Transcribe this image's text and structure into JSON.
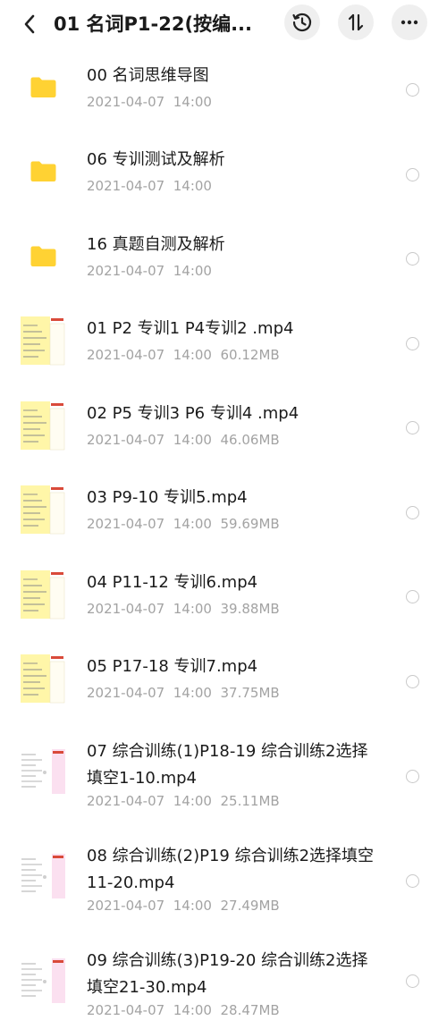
{
  "header": {
    "title": "01 名词P1-22(按编...",
    "back_icon": "back-chevron-icon",
    "history_icon": "history-icon",
    "sort_icon": "sort-icon",
    "more_icon": "more-icon"
  },
  "files": [
    {
      "name": "00 名词思维导图",
      "date": "2021-04-07",
      "time": "14:00",
      "size": "",
      "kind": "folder"
    },
    {
      "name": "06 专训测试及解析",
      "date": "2021-04-07",
      "time": "14:00",
      "size": "",
      "kind": "folder"
    },
    {
      "name": "16 真题自测及解析",
      "date": "2021-04-07",
      "time": "14:00",
      "size": "",
      "kind": "folder"
    },
    {
      "name": "01 P2 专训1 P4专训2 .mp4",
      "date": "2021-04-07",
      "time": "14:00",
      "size": "60.12MB",
      "kind": "video-yellow"
    },
    {
      "name": "02 P5 专训3 P6 专训4 .mp4",
      "date": "2021-04-07",
      "time": "14:00",
      "size": "46.06MB",
      "kind": "video-yellow"
    },
    {
      "name": "03 P9-10 专训5.mp4",
      "date": "2021-04-07",
      "time": "14:00",
      "size": "59.69MB",
      "kind": "video-yellow"
    },
    {
      "name": "04 P11-12 专训6.mp4",
      "date": "2021-04-07",
      "time": "14:00",
      "size": "39.88MB",
      "kind": "video-yellow"
    },
    {
      "name": "05 P17-18 专训7.mp4",
      "date": "2021-04-07",
      "time": "14:00",
      "size": "37.75MB",
      "kind": "video-yellow"
    },
    {
      "name": "07 综合训练(1)P18-19 综合训练2选择填空1-10.mp4",
      "date": "2021-04-07",
      "time": "14:00",
      "size": "25.11MB",
      "kind": "video-white"
    },
    {
      "name": "08 综合训练(2)P19 综合训练2选择填空11-20.mp4",
      "date": "2021-04-07",
      "time": "14:00",
      "size": "27.49MB",
      "kind": "video-white"
    },
    {
      "name": "09 综合训练(3)P19-20 综合训练2选择填空21-30.mp4",
      "date": "2021-04-07",
      "time": "14:00",
      "size": "28.47MB",
      "kind": "video-white"
    }
  ],
  "colors": {
    "folder": "#FFD233",
    "thumb_yellow": "#FFF6A8",
    "thumb_pink": "#FBE0F0",
    "meta_text": "#A3A3A3",
    "header_button_bg": "#EFEFEF"
  }
}
